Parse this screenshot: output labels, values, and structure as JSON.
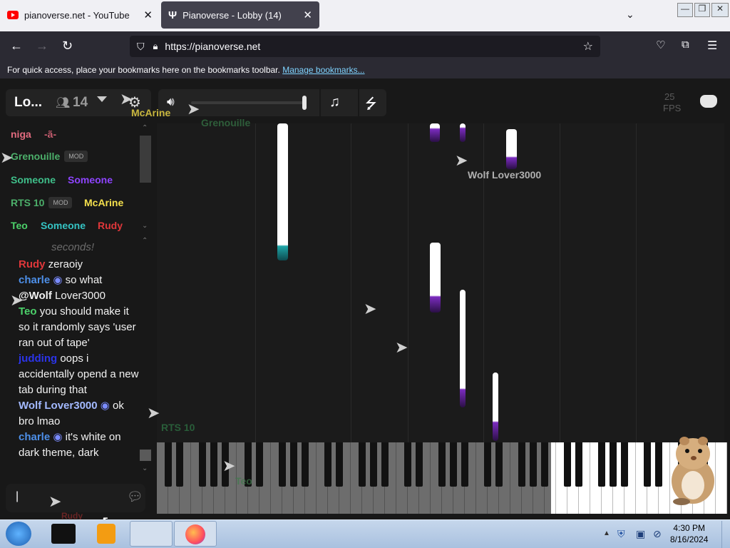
{
  "browser": {
    "tabs": [
      {
        "label": "pianoverse.net - YouTube",
        "active": false
      },
      {
        "label": "Pianoverse - Lobby (14)",
        "active": true
      }
    ],
    "url": "https://pianoverse.net",
    "bookmarks_text": "For quick access, place your bookmarks here on the bookmarks toolbar.",
    "bookmarks_link": "Manage bookmarks..."
  },
  "app": {
    "room_name": "Lo...",
    "user_count": "14",
    "fps_value": "25",
    "fps_label": "FPS",
    "users": [
      {
        "name": "niga",
        "color": "#e36b7f"
      },
      {
        "name": "-ã-",
        "color": "#c65d6f"
      },
      {
        "name": "Grenouille",
        "color": "#4caf6a",
        "mod": true
      },
      {
        "name": "Someone",
        "color": "#3fbf8a"
      },
      {
        "name": "Someone",
        "color": "#8e44ff"
      },
      {
        "name": "RTS 10",
        "color": "#4caf6a",
        "mod": true
      },
      {
        "name": "McArine",
        "color": "#f4e04d"
      },
      {
        "name": "Teo",
        "color": "#4cd16a"
      },
      {
        "name": "Someone",
        "color": "#35c4c4"
      },
      {
        "name": "Rudy",
        "color": "#e0373a"
      }
    ],
    "mod_badge": "MOD",
    "chat": {
      "system_text": "seconds!",
      "messages": [
        {
          "author": "Rudy",
          "color": "#e0373a",
          "text": "zeraoiy"
        },
        {
          "author": "charle",
          "color": "#4d8fe8",
          "text": "so what"
        },
        {
          "author": "@Wolf",
          "color": "#ffffff",
          "text": "Lover3000"
        },
        {
          "author": "Teo",
          "color": "#4cd16a",
          "text": "you should make it so it randomly says 'user ran out of tape'"
        },
        {
          "author": "judding",
          "color": "#2b34e8",
          "text": "oops i accidentally opend a new tab during that"
        },
        {
          "author": "Wolf Lover3000",
          "color": "#a3b9ff",
          "text": "ok bro lmao"
        },
        {
          "author": "charle",
          "color": "#4d8fe8",
          "text": "it's white on dark theme, dark"
        }
      ],
      "input_value": "|"
    },
    "cursors": [
      {
        "name": "McArine",
        "color": "#c9b73e"
      },
      {
        "name": "Grenouille",
        "color": "#3c8a4f"
      },
      {
        "name": "Wolf Lover3000",
        "color": "#b0b0b0"
      },
      {
        "name": "RTS 10",
        "color": "#2f7a46"
      },
      {
        "name": "Teo",
        "color": "#3d7a4a"
      },
      {
        "name": "Rudy",
        "color": "#8a2a2a"
      }
    ]
  },
  "taskbar": {
    "time": "4:30 PM",
    "date": "8/16/2024"
  }
}
